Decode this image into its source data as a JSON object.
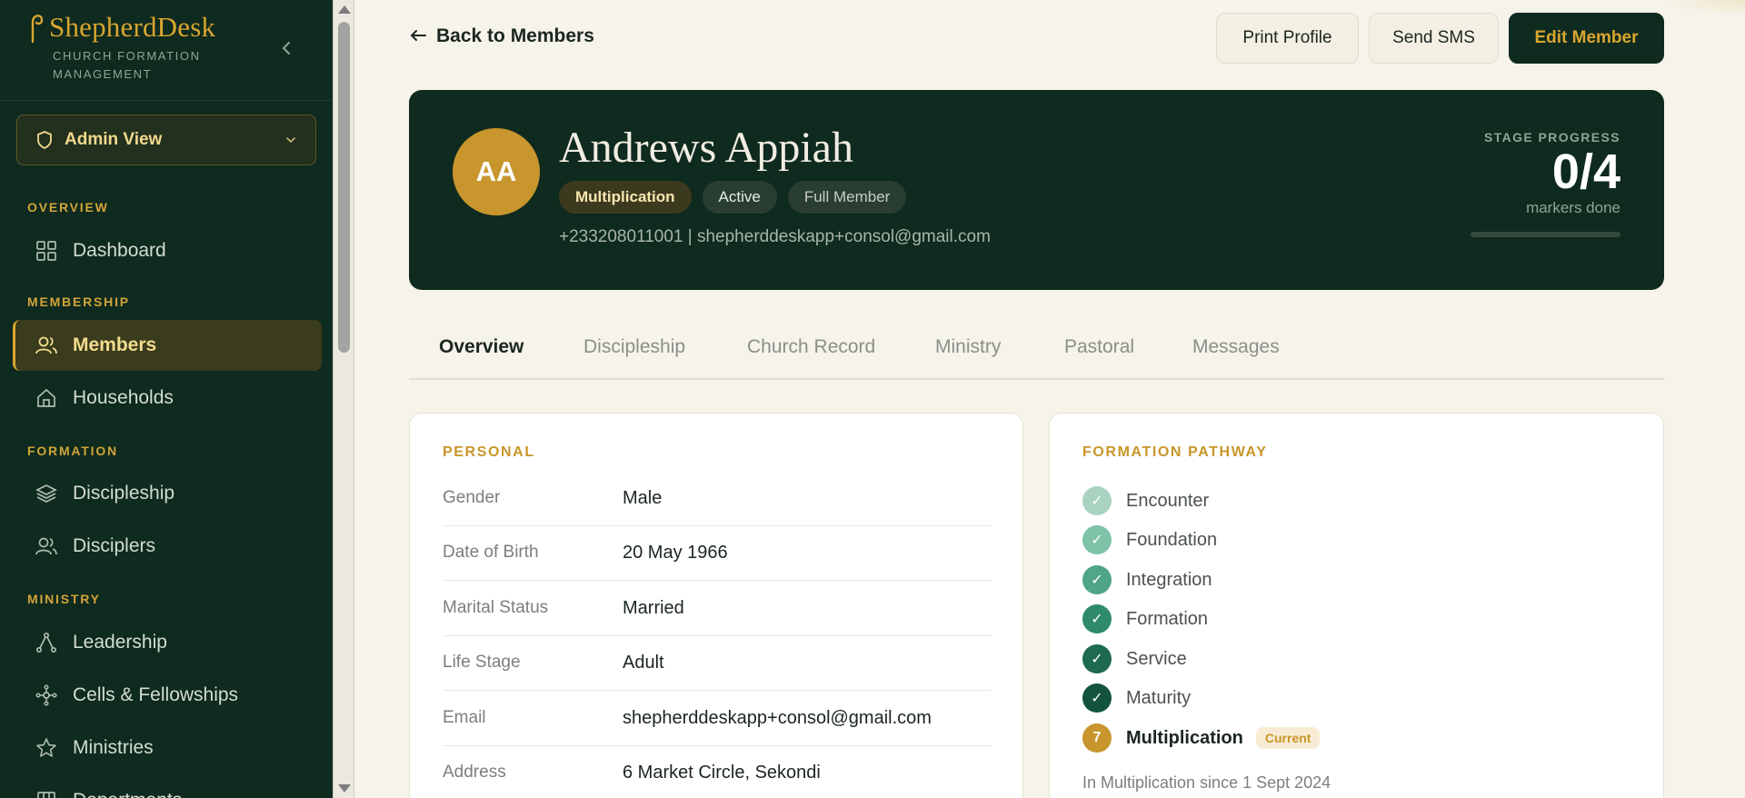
{
  "app": {
    "name": "ShepherdDesk",
    "subtitle": "CHURCH FORMATION MANAGEMENT"
  },
  "view_selector": {
    "label": "Admin View"
  },
  "sidebar": {
    "sections": [
      {
        "label": "OVERVIEW",
        "items": [
          {
            "label": "Dashboard",
            "icon": "grid-icon"
          }
        ]
      },
      {
        "label": "MEMBERSHIP",
        "items": [
          {
            "label": "Members",
            "icon": "users-icon",
            "active": true
          },
          {
            "label": "Households",
            "icon": "home-icon"
          }
        ]
      },
      {
        "label": "FORMATION",
        "items": [
          {
            "label": "Discipleship",
            "icon": "layers-icon"
          },
          {
            "label": "Disciplers",
            "icon": "users-icon"
          }
        ]
      },
      {
        "label": "MINISTRY",
        "items": [
          {
            "label": "Leadership",
            "icon": "network-icon"
          },
          {
            "label": "Cells & Fellowships",
            "icon": "nodes-icon"
          },
          {
            "label": "Ministries",
            "icon": "star-icon"
          },
          {
            "label": "Departments",
            "icon": "building-icon"
          }
        ]
      }
    ]
  },
  "header": {
    "back_label": "Back to Members",
    "print_label": "Print Profile",
    "sms_label": "Send SMS",
    "edit_label": "Edit Member"
  },
  "member": {
    "initials": "AA",
    "name": "Andrews Appiah",
    "stage_badge": "Multiplication",
    "status_badge": "Active",
    "type_badge": "Full Member",
    "contact": "+233208011001 | shepherddeskapp+consol@gmail.com"
  },
  "stage_progress": {
    "label": "STAGE PROGRESS",
    "value": "0/4",
    "sub": "markers done",
    "fraction": 0
  },
  "tabs": [
    {
      "label": "Overview",
      "active": true
    },
    {
      "label": "Discipleship"
    },
    {
      "label": "Church Record"
    },
    {
      "label": "Ministry"
    },
    {
      "label": "Pastoral"
    },
    {
      "label": "Messages"
    }
  ],
  "personal": {
    "title": "PERSONAL",
    "fields": [
      {
        "label": "Gender",
        "value": "Male"
      },
      {
        "label": "Date of Birth",
        "value": "20 May 1966"
      },
      {
        "label": "Marital Status",
        "value": "Married"
      },
      {
        "label": "Life Stage",
        "value": "Adult"
      },
      {
        "label": "Email",
        "value": "shepherddeskapp+consol@gmail.com"
      },
      {
        "label": "Address",
        "value": "6 Market Circle, Sekondi"
      }
    ]
  },
  "pathway": {
    "title": "FORMATION PATHWAY",
    "steps": [
      {
        "label": "Encounter",
        "mark": "✓",
        "color": "#a9d3c0"
      },
      {
        "label": "Foundation",
        "mark": "✓",
        "color": "#7ec2a7"
      },
      {
        "label": "Integration",
        "mark": "✓",
        "color": "#4fa585"
      },
      {
        "label": "Formation",
        "mark": "✓",
        "color": "#2e8a68"
      },
      {
        "label": "Service",
        "mark": "✓",
        "color": "#1d6a4e"
      },
      {
        "label": "Maturity",
        "mark": "✓",
        "color": "#13533c"
      },
      {
        "label": "Multiplication",
        "mark": "7",
        "color": "#c8962d",
        "current": true
      }
    ],
    "current_label": "Current",
    "since": "In Multiplication since 1 Sept 2024"
  },
  "colors": {
    "sidebar_bg": "#0f2a1e",
    "accent_gold": "#d8a630",
    "page_bg": "#f6f3ea"
  }
}
